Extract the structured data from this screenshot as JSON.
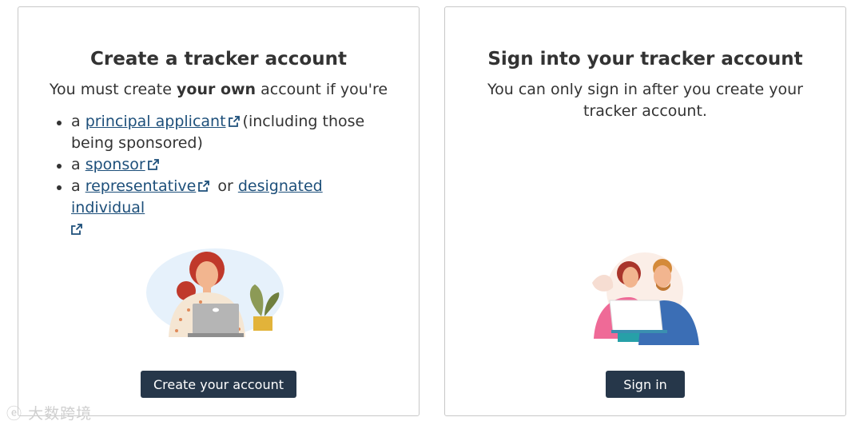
{
  "create_card": {
    "title": "Create a tracker account",
    "intro_pre": "You must create ",
    "intro_bold": "your own",
    "intro_post": " account if you're",
    "bullets": {
      "item1_prefix": "a ",
      "item1_link": "principal applicant",
      "item1_suffix": "(including those being sponsored)",
      "item2_prefix": "a ",
      "item2_link": "sponsor",
      "item3_prefix": "a ",
      "item3_link": "representative",
      "item3_middle": " or ",
      "item3_link2": "designated individual"
    },
    "button_label": "Create your account"
  },
  "signin_card": {
    "title": "Sign into your tracker account",
    "subtitle": "You can only sign in after you create your tracker account.",
    "button_label": "Sign in"
  },
  "watermark": "大数跨境",
  "icons": {
    "external_link": "external-link-icon"
  },
  "colors": {
    "button_bg": "#26374a",
    "link": "#1d4f7a",
    "text": "#333333",
    "border": "#c8c8c8"
  }
}
